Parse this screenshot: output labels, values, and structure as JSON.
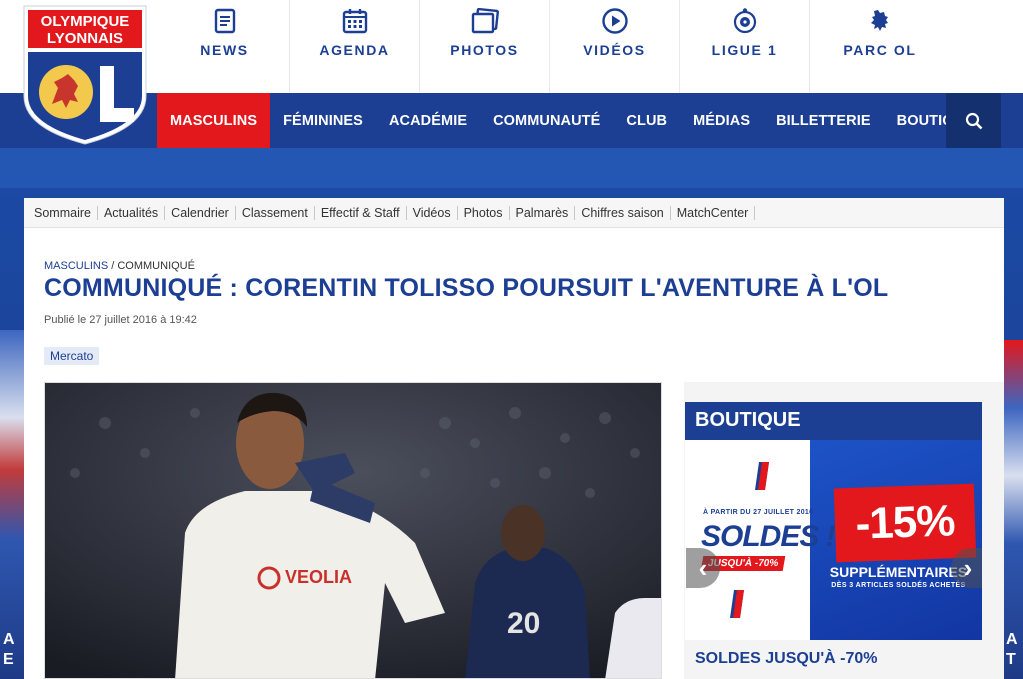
{
  "logo": {
    "line1": "OLYMPIQUE",
    "line2": "LYONNAIS",
    "mark": "OL"
  },
  "topnav": [
    {
      "label": "NEWS",
      "icon": "news-icon"
    },
    {
      "label": "AGENDA",
      "icon": "calendar-icon"
    },
    {
      "label": "PHOTOS",
      "icon": "photos-icon"
    },
    {
      "label": "VIDÉOS",
      "icon": "play-icon"
    },
    {
      "label": "LIGUE 1",
      "icon": "ligue1-icon"
    },
    {
      "label": "PARC OL",
      "icon": "lion-icon"
    }
  ],
  "mainnav": [
    {
      "label": "MASCULINS",
      "active": true
    },
    {
      "label": "FÉMININES"
    },
    {
      "label": "ACADÉMIE"
    },
    {
      "label": "COMMUNAUTÉ"
    },
    {
      "label": "CLUB"
    },
    {
      "label": "MÉDIAS"
    },
    {
      "label": "BILLETTERIE"
    },
    {
      "label": "BOUTIQUE"
    }
  ],
  "subnav": [
    "Sommaire",
    "Actualités",
    "Calendrier",
    "Classement",
    "Effectif & Staff",
    "Vidéos",
    "Photos",
    "Palmarès",
    "Chiffres saison",
    "MatchCenter"
  ],
  "article": {
    "breadcrumb_section": "MASCULINS",
    "breadcrumb_sep": " / ",
    "breadcrumb_current": "COMMUNIQUÉ",
    "title": "COMMUNIQUÉ : CORENTIN TOLISSO POURSUIT L'AVENTURE À L'OL",
    "published": "Publié le 27 juillet 2016 à 19:42",
    "tag": "Mercato",
    "photo_sponsor": "VEOLIA",
    "photo_number": "20"
  },
  "boutique": {
    "heading": "BOUTIQUE",
    "from": "À PARTIR DU 27 JUILLET 2016",
    "soldes": "SOLDES !",
    "jusqua": "JUSQU'À -70%",
    "discount": "-15%",
    "supp": "SUPPLÉMENTAIRES",
    "supp_detail": "DÈS 3 ARTICLES SOLDÉS ACHETÉS",
    "promo_title": "SOLDES JUSQU'À -70%",
    "prev": "‹",
    "next": "›"
  },
  "side": {
    "left_text": "A\nE",
    "right_text": "A\nT"
  },
  "colors": {
    "brand_blue": "#1c3f94",
    "brand_red": "#e2181d"
  }
}
